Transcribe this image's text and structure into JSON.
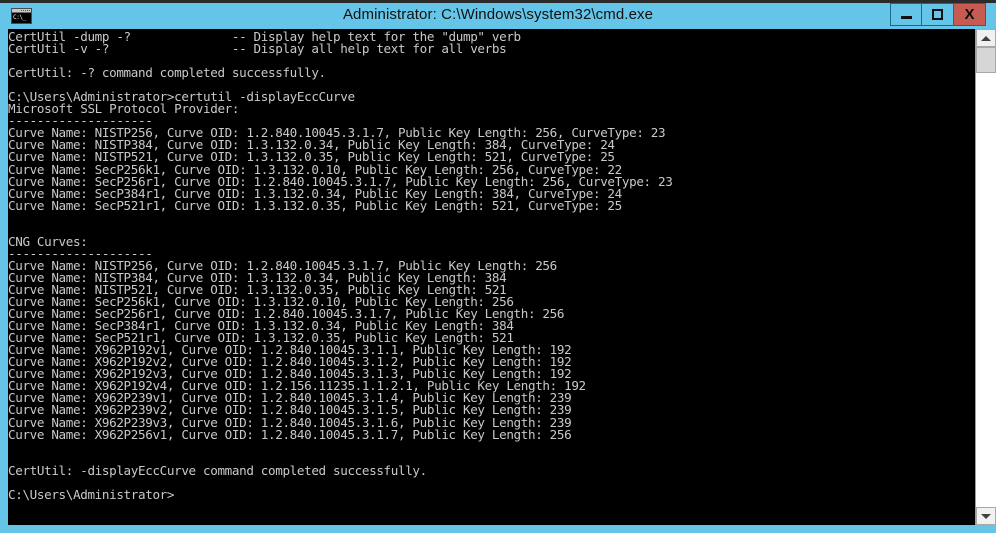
{
  "window": {
    "title": "Administrator: C:\\Windows\\system32\\cmd.exe",
    "icon_name": "cmd-console-icon",
    "icon_text": "C:\\_",
    "colors": {
      "titlebar": "#65c5e8",
      "close_button": "#c75b52",
      "console_background": "#000000",
      "console_text": "#c9c9c9"
    },
    "buttons": {
      "minimize": "–",
      "maximize": "□",
      "close": "X"
    }
  },
  "scrollbar": {
    "up_arrow": "▲",
    "down_arrow": "▼",
    "thumb_position_percent": 0
  },
  "console": {
    "lines": [
      "CertUtil -dump -?              -- Display help text for the \"dump\" verb",
      "CertUtil -v -?                 -- Display all help text for all verbs",
      "",
      "CertUtil: -? command completed successfully.",
      "",
      "C:\\Users\\Administrator>certutil -displayEccCurve",
      "Microsoft SSL Protocol Provider:",
      "--------------------",
      "Curve Name: NISTP256, Curve OID: 1.2.840.10045.3.1.7, Public Key Length: 256, CurveType: 23",
      "Curve Name: NISTP384, Curve OID: 1.3.132.0.34, Public Key Length: 384, CurveType: 24",
      "Curve Name: NISTP521, Curve OID: 1.3.132.0.35, Public Key Length: 521, CurveType: 25",
      "Curve Name: SecP256k1, Curve OID: 1.3.132.0.10, Public Key Length: 256, CurveType: 22",
      "Curve Name: SecP256r1, Curve OID: 1.2.840.10045.3.1.7, Public Key Length: 256, CurveType: 23",
      "Curve Name: SecP384r1, Curve OID: 1.3.132.0.34, Public Key Length: 384, CurveType: 24",
      "Curve Name: SecP521r1, Curve OID: 1.3.132.0.35, Public Key Length: 521, CurveType: 25",
      "",
      "",
      "CNG Curves:",
      "--------------------",
      "Curve Name: NISTP256, Curve OID: 1.2.840.10045.3.1.7, Public Key Length: 256",
      "Curve Name: NISTP384, Curve OID: 1.3.132.0.34, Public Key Length: 384",
      "Curve Name: NISTP521, Curve OID: 1.3.132.0.35, Public Key Length: 521",
      "Curve Name: SecP256k1, Curve OID: 1.3.132.0.10, Public Key Length: 256",
      "Curve Name: SecP256r1, Curve OID: 1.2.840.10045.3.1.7, Public Key Length: 256",
      "Curve Name: SecP384r1, Curve OID: 1.3.132.0.34, Public Key Length: 384",
      "Curve Name: SecP521r1, Curve OID: 1.3.132.0.35, Public Key Length: 521",
      "Curve Name: X962P192v1, Curve OID: 1.2.840.10045.3.1.1, Public Key Length: 192",
      "Curve Name: X962P192v2, Curve OID: 1.2.840.10045.3.1.2, Public Key Length: 192",
      "Curve Name: X962P192v3, Curve OID: 1.2.840.10045.3.1.3, Public Key Length: 192",
      "Curve Name: X962P192v4, Curve OID: 1.2.156.11235.1.1.2.1, Public Key Length: 192",
      "Curve Name: X962P239v1, Curve OID: 1.2.840.10045.3.1.4, Public Key Length: 239",
      "Curve Name: X962P239v2, Curve OID: 1.2.840.10045.3.1.5, Public Key Length: 239",
      "Curve Name: X962P239v3, Curve OID: 1.2.840.10045.3.1.6, Public Key Length: 239",
      "Curve Name: X962P256v1, Curve OID: 1.2.840.10045.3.1.7, Public Key Length: 256",
      "",
      "",
      "CertUtil: -displayEccCurve command completed successfully.",
      "",
      "C:\\Users\\Administrator>"
    ]
  }
}
